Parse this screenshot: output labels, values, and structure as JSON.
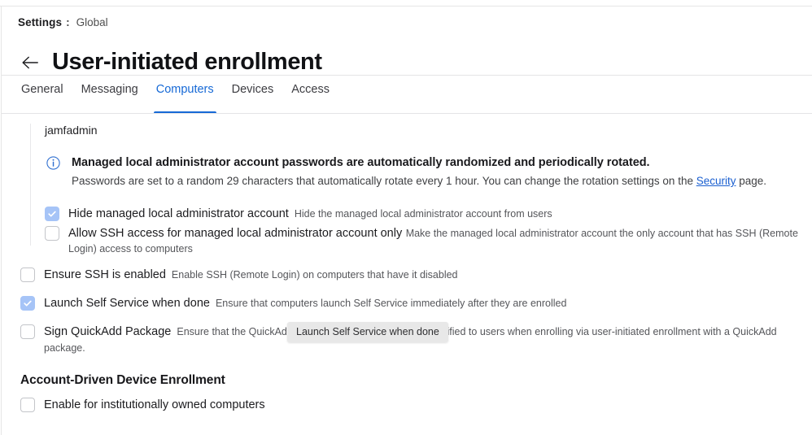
{
  "window": {
    "breadcrumb": {
      "root": "Settings",
      "separator": ":",
      "scope": "Global"
    },
    "back_label": "←",
    "title": "User-initiated enrollment"
  },
  "tabs": [
    {
      "label": "General",
      "active": false
    },
    {
      "label": "Messaging",
      "active": false
    },
    {
      "label": "Computers",
      "active": true
    },
    {
      "label": "Devices",
      "active": false
    },
    {
      "label": "Access",
      "active": false
    }
  ],
  "managed_admin": {
    "account_name": "jamfadmin",
    "info": {
      "icon": "info-circle-icon",
      "title": "Managed local administrator account passwords are automatically randomized and periodically rotated.",
      "description_before": "Passwords are set to a random 29 characters that automatically rotate every 1 hour. You can change the rotation settings on the ",
      "link_text": "Security",
      "description_after": " page."
    },
    "checkboxes": [
      {
        "label": "Hide managed local administrator account",
        "side_note": "Hide the managed local administrator account from users",
        "description": "",
        "checked": true
      },
      {
        "label": "Allow SSH access for managed local administrator account only",
        "side_note": "",
        "description": "Make the managed local administrator account the only account that has SSH (Remote Login) access to computers",
        "checked": false
      }
    ]
  },
  "main_options": [
    {
      "label": "Ensure SSH is enabled",
      "side_note": "Enable SSH (Remote Login) on computers that have it disabled",
      "checked": false
    },
    {
      "label": "Launch Self Service when done",
      "side_note": "Ensure that computers launch Self Service immediately after they are enrolled",
      "checked": true
    },
    {
      "label": "Sign QuickAdd Package",
      "side_note": "Ensure that the QuickAdd package is signed and can be verified to users when enrolling via user-initiated enrollment with a QuickAdd package.",
      "checked": false
    }
  ],
  "account_driven_section": {
    "heading": "Account-Driven Device Enrollment",
    "checkboxes": [
      {
        "label": "Enable for institutionally owned computers",
        "side_note": "",
        "checked": false
      }
    ]
  },
  "tooltip": {
    "text": "Launch Self Service when done"
  },
  "colors": {
    "accent": "#1669d6",
    "link": "#1a5fd0",
    "checkbox_checked": "#a6c4f7",
    "tooltip_bg": "#e8e8e8"
  }
}
